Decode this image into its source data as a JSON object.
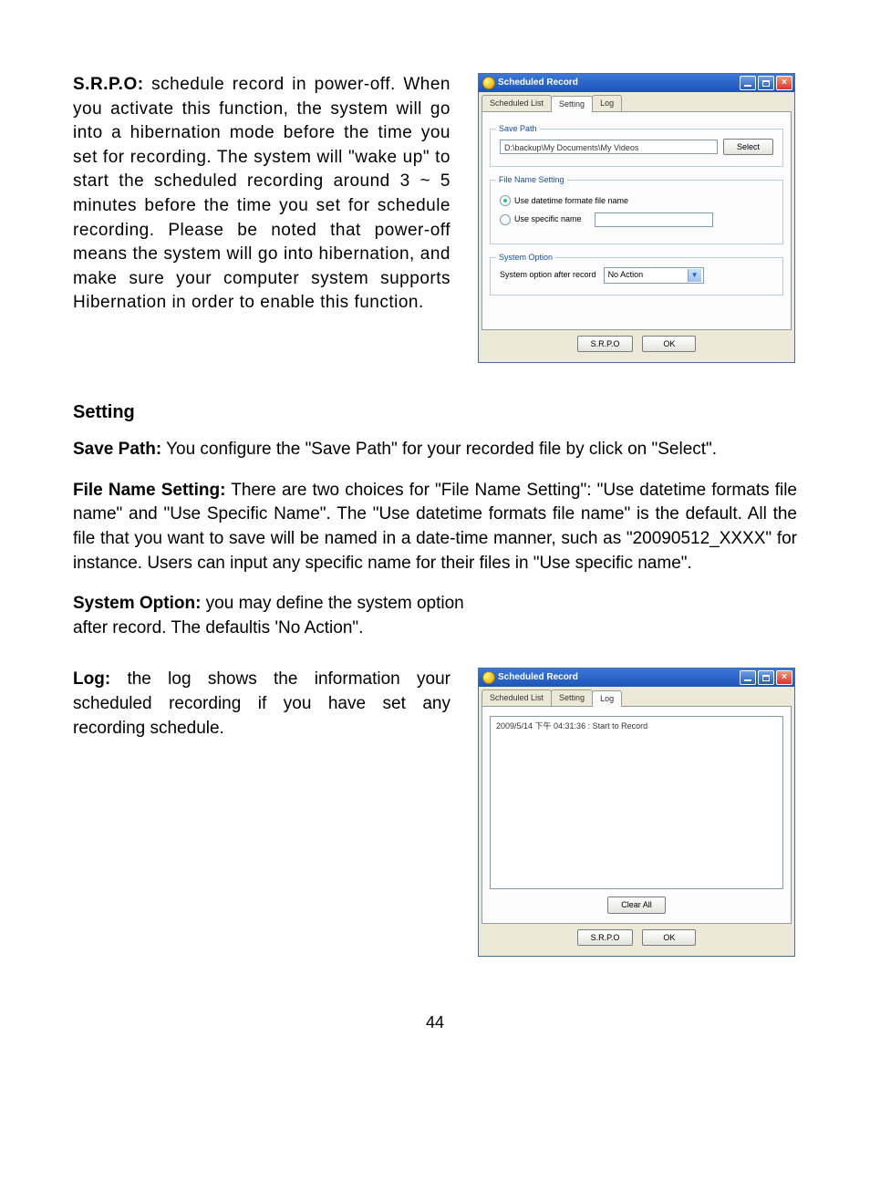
{
  "body": {
    "srpo_label": "S.R.P.O:",
    "srpo_text": " schedule record in power-off. When you activate this function, the system will go into a hibernation mode before the time you set for recording. The system will \"wake up\" to start the scheduled recording around 3 ~ 5 minutes before the time you set for schedule recording. Please be noted that power-off means the system will go into hibernation, and make sure your computer system supports Hibernation in order to enable this function.",
    "setting_heading": "Setting",
    "save_path_label": "Save Path:",
    "save_path_text": " You configure the \"Save Path\" for your recorded file by click on \"Select\".",
    "fns_label": "File Name Setting:",
    "fns_text": " There are two choices for \"File Name Setting\": \"Use datetime formats file name\" and \"Use Specific Name\". The \"Use datetime formats file name\" is the default. All the file that you want to save will be named in a date-time manner, such as \"20090512_XXXX\" for instance. Users can input any specific name for their files in \"Use specific name\".",
    "sysopt_label": "System Option:",
    "sysopt_text1": " you may define the system option",
    "sysopt_text2": "after record. The defaultis 'No Action\".",
    "log_label": "Log:",
    "log_text": " the log shows the information your scheduled recording if you have set any recording schedule.",
    "page_number": "44"
  },
  "dialog": {
    "title": "Scheduled Record",
    "tabs": {
      "list": "Scheduled List",
      "setting": "Setting",
      "log": "Log"
    },
    "setting": {
      "save_legend": "Save Path",
      "save_value": "D:\\backup\\My Documents\\My Videos",
      "select_btn": "Select",
      "fns_legend": "File Name Setting",
      "radio_dt": "Use datetime formate file name",
      "radio_specific": "Use specific name",
      "sys_legend": "System Option",
      "sys_label": "System option after record",
      "sys_value": "No Action"
    },
    "log": {
      "entry": "2009/5/14 下午 04:31:36 : Start to Record",
      "clear_btn": "Clear All"
    },
    "bottom": {
      "srpo": "S.R.P.O",
      "ok": "OK"
    }
  }
}
